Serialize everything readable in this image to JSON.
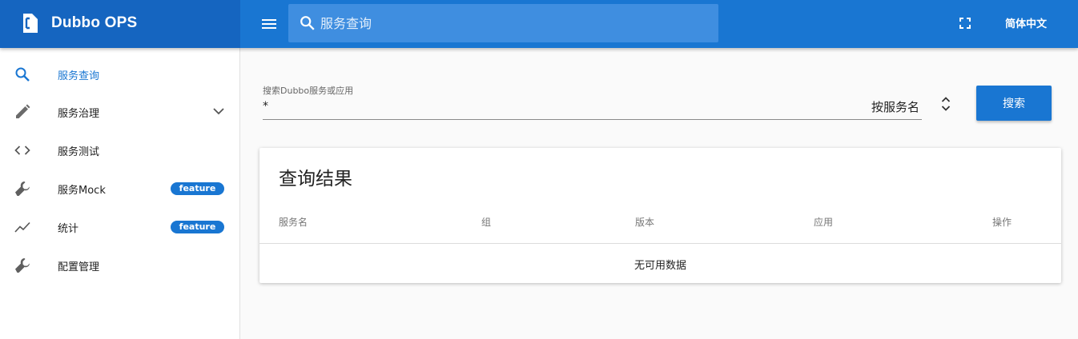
{
  "app": {
    "title": "Dubbo OPS",
    "language_button": "简体中文"
  },
  "top_search": {
    "placeholder": "服务查询"
  },
  "sidebar": {
    "items": [
      {
        "label": "服务查询",
        "icon": "search-icon",
        "active": true
      },
      {
        "label": "服务治理",
        "icon": "pencil-icon",
        "expandable": true
      },
      {
        "label": "服务测试",
        "icon": "code-icon"
      },
      {
        "label": "服务Mock",
        "icon": "wrench-icon",
        "badge": "feature"
      },
      {
        "label": "统计",
        "icon": "trending-icon",
        "badge": "feature"
      },
      {
        "label": "配置管理",
        "icon": "wrench-icon"
      }
    ]
  },
  "search_form": {
    "label": "搜索Dubbo服务或应用",
    "value": "*",
    "select_value": "按服务名",
    "button": "搜索"
  },
  "results": {
    "title": "查询结果",
    "columns": [
      "服务名",
      "组",
      "版本",
      "应用",
      "操作"
    ],
    "empty_text": "无可用数据"
  },
  "colors": {
    "primary": "#1976d2",
    "primary_dark": "#1565c0"
  }
}
